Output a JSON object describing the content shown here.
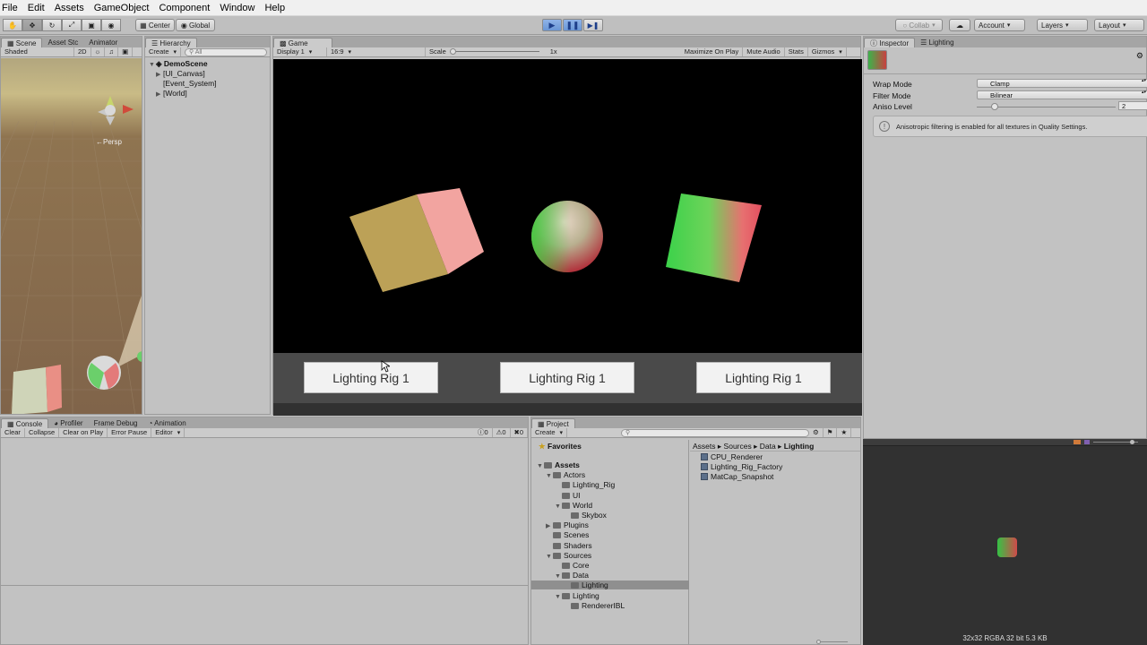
{
  "menu": [
    "File",
    "Edit",
    "Assets",
    "GameObject",
    "Component",
    "Window",
    "Help"
  ],
  "toolbar": {
    "pivot": "Center",
    "space": "Global",
    "collab": "Collab",
    "account": "Account",
    "layers": "Layers",
    "layout": "Layout"
  },
  "scene_panel": {
    "tabs": [
      "Scene",
      "Asset Stc",
      "Animator"
    ],
    "shading": "Shaded",
    "mode_2d": "2D",
    "persp_label": "←Persp"
  },
  "hierarchy": {
    "tab": "Hierarchy",
    "create": "Create",
    "search_placeholder": "All",
    "scene": "DemoScene",
    "items": [
      "[UI_Canvas]",
      "[Event_System]",
      "[World]"
    ]
  },
  "game": {
    "tab": "Game",
    "display": "Display 1",
    "aspect": "16:9",
    "scale_label": "Scale",
    "scale_value": "1x",
    "maximize": "Maximize On Play",
    "mute": "Mute Audio",
    "stats": "Stats",
    "gizmos": "Gizmos",
    "buttons": [
      "Lighting Rig 1",
      "Lighting Rig 1",
      "Lighting Rig 1"
    ]
  },
  "inspector": {
    "tabs": [
      "Inspector",
      "Lighting"
    ],
    "wrap_mode_label": "Wrap Mode",
    "wrap_mode_value": "Clamp",
    "filter_mode_label": "Filter Mode",
    "filter_mode_value": "Bilinear",
    "aniso_label": "Aniso Level",
    "aniso_value": "2",
    "aniso_level": 2,
    "help_text": "Anisotropic filtering is enabled for all textures in Quality Settings."
  },
  "preview": {
    "info": "32x32  RGBA 32 bit   5.3 KB"
  },
  "console": {
    "tabs": [
      "Console",
      "Profiler",
      "Frame Debug",
      "Animation"
    ],
    "buttons": [
      "Clear",
      "Collapse",
      "Clear on Play",
      "Error Pause",
      "Editor"
    ],
    "counts": [
      "0",
      "0",
      "0"
    ]
  },
  "project": {
    "tab": "Project",
    "create": "Create",
    "favorites": "Favorites",
    "tree": [
      {
        "label": "Assets",
        "depth": 0,
        "arrow": "▼",
        "bold": true
      },
      {
        "label": "Actors",
        "depth": 1,
        "arrow": "▼"
      },
      {
        "label": "Lighting_Rig",
        "depth": 2,
        "arrow": ""
      },
      {
        "label": "UI",
        "depth": 2,
        "arrow": ""
      },
      {
        "label": "World",
        "depth": 2,
        "arrow": "▼"
      },
      {
        "label": "Skybox",
        "depth": 3,
        "arrow": ""
      },
      {
        "label": "Plugins",
        "depth": 1,
        "arrow": "▶"
      },
      {
        "label": "Scenes",
        "depth": 1,
        "arrow": ""
      },
      {
        "label": "Shaders",
        "depth": 1,
        "arrow": ""
      },
      {
        "label": "Sources",
        "depth": 1,
        "arrow": "▼"
      },
      {
        "label": "Core",
        "depth": 2,
        "arrow": ""
      },
      {
        "label": "Data",
        "depth": 2,
        "arrow": "▼"
      },
      {
        "label": "Lighting",
        "depth": 3,
        "arrow": "",
        "selected": true
      },
      {
        "label": "Lighting",
        "depth": 2,
        "arrow": "▼"
      },
      {
        "label": "RendererIBL",
        "depth": 3,
        "arrow": ""
      }
    ],
    "breadcrumb": [
      "Assets",
      "Sources",
      "Data",
      "Lighting"
    ],
    "files": [
      "CPU_Renderer",
      "Lighting_Rig_Factory",
      "MatCap_Snapshot"
    ]
  }
}
